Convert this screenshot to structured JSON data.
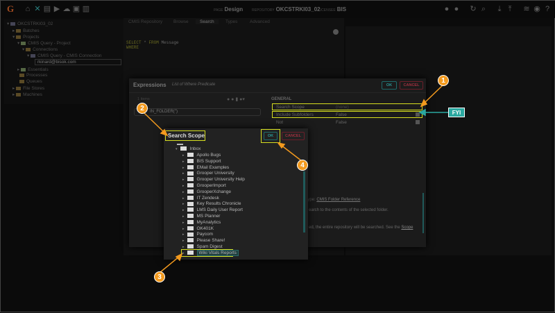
{
  "topbar": {
    "page_label": "PAGE",
    "page": "Design",
    "repo_label": "REPOSITORY",
    "repo": "OKCSTRKI03_02",
    "licensee_label": "LICENSEE",
    "licensee": "BIS"
  },
  "tree": {
    "items": [
      "OKCSTRKI03_02",
      "Batches",
      "Projects",
      "CMIS Query - Project",
      "Connections",
      "CMIS Query - CMIS Connection",
      "rkinard@bisok.com",
      "Essentials",
      "Processes",
      "Queues",
      "File Stores",
      "Machines"
    ]
  },
  "tabs": [
    "CMIS Repository",
    "Browse",
    "Search",
    "Types",
    "Advanced"
  ],
  "query": {
    "select": "SELECT",
    "star": "*",
    "from": "FROM",
    "table": "Message",
    "where": "WHERE"
  },
  "expressions": {
    "title": "Expressions",
    "subtitle": "List of Where Predicate",
    "ok": "OK",
    "cancel": "CANCEL",
    "count": "1 items",
    "item": "IN_FOLDER('')",
    "general": "GENERAL",
    "props": [
      {
        "name": "Search Scope",
        "value": "(none)"
      },
      {
        "name": "Include Subfolders",
        "value": "False"
      },
      {
        "name": "Not",
        "value": "False"
      }
    ],
    "type_label": "Type:",
    "type_link": "CMIS Folder Reference",
    "desc1": "earch to the contents of the selected folder.",
    "desc2": "ed, the entire repository will be searched. See the",
    "desc_link": "Scope"
  },
  "scope": {
    "title": "Search Scope",
    "ok": "OK",
    "cancel": "CANCEL",
    "root": "Inbox",
    "folders": [
      "Apollo Bugs",
      "BIS Support",
      "EMail Examples",
      "Grooper University",
      "Grooper University Help",
      "GrooperImport",
      "GrooperXchange",
      "IT Zendesk",
      "Key Results Chronicle",
      "LMS Daily User Report",
      "MS Planner",
      "MyAnalytics",
      "OK401K",
      "Paycom",
      "Please Share!",
      "Spam Digest"
    ],
    "selected": "Wiki Vitals Reports"
  },
  "callouts": {
    "c1": "1",
    "c2": "2",
    "c3": "3",
    "c4": "4",
    "fyi": "FYI"
  },
  "colors": {
    "accent": "#2a9a9a",
    "highlight": "#d8e020",
    "callout": "#f39a1e"
  }
}
